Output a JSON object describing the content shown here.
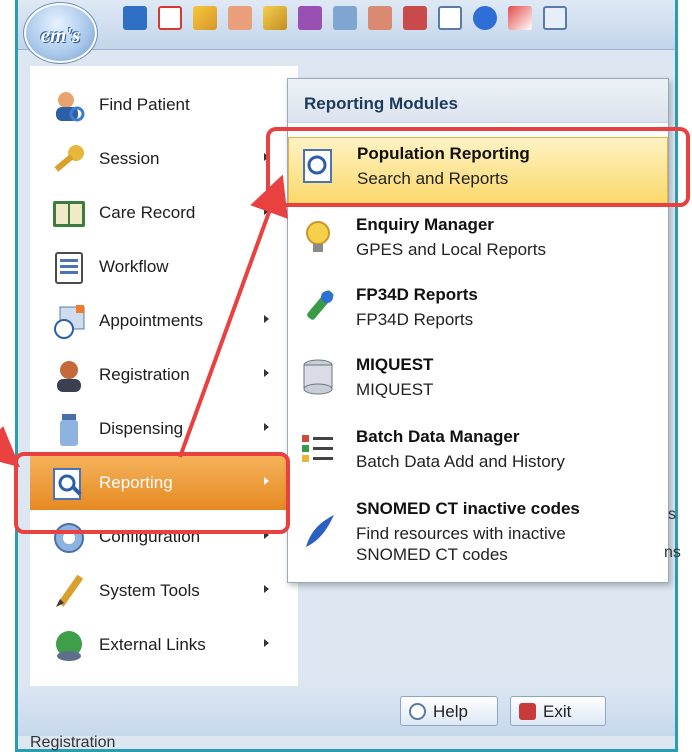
{
  "app": {
    "logo_text": "em's"
  },
  "toolbar": {
    "icons": [
      "back-icon",
      "home-icon",
      "pencil-icon",
      "users-icon",
      "wand-icon",
      "notes-icon",
      "calendar-clock-icon",
      "group-icon",
      "calendar-icon",
      "document-icon",
      "info-icon",
      "pen-icon",
      "window-icon"
    ]
  },
  "menu": {
    "items": [
      {
        "label": "Find Patient",
        "icon": "find-patient-icon",
        "has_submenu": false
      },
      {
        "label": "Session",
        "icon": "key-icon",
        "has_submenu": true
      },
      {
        "label": "Care Record",
        "icon": "care-record-icon",
        "has_submenu": true
      },
      {
        "label": "Workflow",
        "icon": "workflow-icon",
        "has_submenu": false
      },
      {
        "label": "Appointments",
        "icon": "calendar-clock-icon",
        "has_submenu": true
      },
      {
        "label": "Registration",
        "icon": "person-icon",
        "has_submenu": true
      },
      {
        "label": "Dispensing",
        "icon": "bottle-icon",
        "has_submenu": true
      },
      {
        "label": "Reporting",
        "icon": "report-search-icon",
        "has_submenu": true,
        "active": true
      },
      {
        "label": "Configuration",
        "icon": "configuration-icon",
        "has_submenu": true
      },
      {
        "label": "System Tools",
        "icon": "pencil-icon",
        "has_submenu": true
      },
      {
        "label": "External Links",
        "icon": "globe-link-icon",
        "has_submenu": true
      }
    ]
  },
  "submenu": {
    "title": "Reporting Modules",
    "items": [
      {
        "title": "Population Reporting",
        "desc": "Search and Reports",
        "icon": "report-search-icon",
        "active": true
      },
      {
        "title": "Enquiry Manager",
        "desc": "GPES and Local Reports",
        "icon": "lightbulb-icon"
      },
      {
        "title": "FP34D Reports",
        "desc": "FP34D Reports",
        "icon": "dropper-icon"
      },
      {
        "title": "MIQUEST",
        "desc": "MIQUEST",
        "icon": "database-icon"
      },
      {
        "title": "Batch Data Manager",
        "desc": "Batch Data Add and History",
        "icon": "batch-list-icon"
      },
      {
        "title": "SNOMED CT inactive codes",
        "desc_line1": "Find resources with inactive",
        "desc_line2": "SNOMED CT codes",
        "icon": "funnel-icon"
      }
    ]
  },
  "footer": {
    "help_label": "Help",
    "exit_label": "Exit",
    "background_text": "Registration"
  },
  "edge_text": {
    "s1": "s",
    "s2": "ns"
  },
  "colors": {
    "highlight": "#e8413f",
    "frame": "#2a9db2",
    "active_menu": "#e68a22",
    "active_submenu": "#fbd86a"
  }
}
